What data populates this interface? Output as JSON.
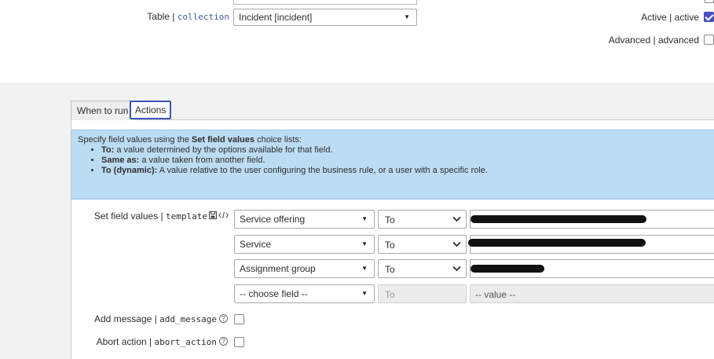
{
  "form": {
    "table_label": "Table",
    "table_sep": "|",
    "table_code": "collection",
    "table_value": "Incident [incident]",
    "active_label": "Active",
    "active_sep": "|",
    "active_code": "active",
    "active_checked": true,
    "advanced_label": "Advanced",
    "advanced_sep": "|",
    "advanced_code": "advanced",
    "advanced_checked": false
  },
  "tabs": [
    {
      "label": "When to run",
      "active": false
    },
    {
      "label": "Actions",
      "active": true
    }
  ],
  "info": {
    "intro_prefix": "Specify field values using the ",
    "intro_bold": "Set field values",
    "intro_suffix": " choice lists:",
    "items": [
      {
        "term": "To:",
        "text": " a value determined by the options available for that field."
      },
      {
        "term": "Same as:",
        "text": " a value taken from another field."
      },
      {
        "term": "To (dynamic):",
        "text": " A value relative to the user configuring the business rule, or a user with a specific role."
      }
    ]
  },
  "set_field": {
    "label": "Set field values",
    "sep": "|",
    "code": "template",
    "rows": [
      {
        "field": "Service offering",
        "op": "To",
        "value_redacted": true
      },
      {
        "field": "Service",
        "op": "To",
        "value_redacted": true
      },
      {
        "field": "Assignment group",
        "op": "To",
        "value_redacted": true
      },
      {
        "field": "-- choose field --",
        "op": "To",
        "value": "-- value --",
        "disabled": true
      }
    ]
  },
  "add_message": {
    "label": "Add message",
    "sep": "|",
    "code": "add_message",
    "checked": false
  },
  "abort_action": {
    "label": "Abort action",
    "sep": "|",
    "code": "abort_action",
    "checked": false
  },
  "icons": {
    "save_template": "save-icon",
    "script": "code-icon",
    "help": "help-circle-icon"
  }
}
